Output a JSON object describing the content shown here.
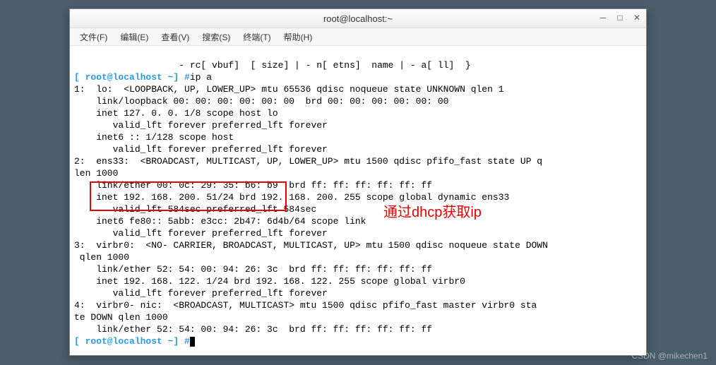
{
  "window": {
    "title": "root@localhost:~"
  },
  "menu": {
    "file": "文件(F)",
    "edit": "编辑(E)",
    "view": "查看(V)",
    "search": "搜索(S)",
    "terminal": "终端(T)",
    "help": "帮助(H)"
  },
  "term": {
    "line0": "                   - rc[ vbuf]  [ size] | - n[ etns]  name | - a[ ll]  }",
    "prompt1": "[ root@localhost ~] #",
    "cmd1": "ip a",
    "out1": "1:  lo:  <LOOPBACK, UP, LOWER_UP> mtu 65536 qdisc noqueue state UNKNOWN qlen 1",
    "out2": "    link/loopback 00: 00: 00: 00: 00: 00  brd 00: 00: 00: 00: 00: 00",
    "out3": "    inet 127. 0. 0. 1/8 scope host lo",
    "out4": "       valid_lft forever preferred_lft forever",
    "out5": "    inet6 :: 1/128 scope host",
    "out6": "       valid_lft forever preferred_lft forever",
    "out7": "2:  ens33:  <BROADCAST, MULTICAST, UP, LOWER_UP> mtu 1500 qdisc pfifo_fast state UP q",
    "out7b": "len 1000",
    "out8": "    link/ether 00: 0c: 29: 35: b6: b9  brd ff: ff: ff: ff: ff: ff",
    "out9": "    inet 192. 168. 200. 51/24 brd 192. 168. 200. 255 scope global dynamic ens33",
    "out10": "       valid_lft 584sec preferred_lft 584sec",
    "out11": "    inet6 fe80:: 5abb: e3cc: 2b47: 6d4b/64 scope link",
    "out12": "       valid_lft forever preferred_lft forever",
    "out13": "3:  virbr0:  <NO- CARRIER, BROADCAST, MULTICAST, UP> mtu 1500 qdisc noqueue state DOWN",
    "out13b": " qlen 1000",
    "out14": "    link/ether 52: 54: 00: 94: 26: 3c  brd ff: ff: ff: ff: ff: ff",
    "out15": "    inet 192. 168. 122. 1/24 brd 192. 168. 122. 255 scope global virbr0",
    "out16": "       valid_lft forever preferred_lft forever",
    "out17": "4:  virbr0- nic:  <BROADCAST, MULTICAST> mtu 1500 qdisc pfifo_fast master virbr0 sta",
    "out17b": "te DOWN qlen 1000",
    "out18": "    link/ether 52: 54: 00: 94: 26: 3c  brd ff: ff: ff: ff: ff: ff",
    "prompt2": "[ root@localhost ~] #"
  },
  "annotation": "通过dhcp获取ip",
  "watermark": "CSDN @mikechen1"
}
